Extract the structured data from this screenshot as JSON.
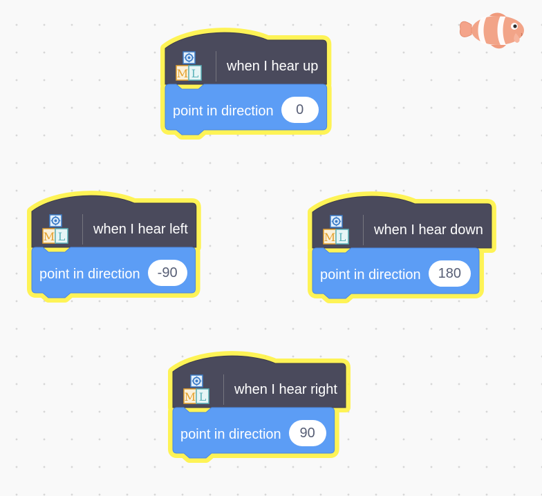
{
  "stacks": [
    {
      "hat_label": "when I hear up",
      "command_label": "point in direction",
      "value": "0",
      "icon": "ml-blocks-icon"
    },
    {
      "hat_label": "when I hear left",
      "command_label": "point in direction",
      "value": "-90",
      "icon": "ml-blocks-icon"
    },
    {
      "hat_label": "when I hear down",
      "command_label": "point in direction",
      "value": "180",
      "icon": "ml-blocks-icon"
    },
    {
      "hat_label": "when I hear right",
      "command_label": "point in direction",
      "value": "90",
      "icon": "ml-blocks-icon"
    }
  ],
  "icon_letters": {
    "left": "M",
    "right": "L"
  },
  "sprite": {
    "icon": "clownfish-sprite-icon"
  },
  "colors": {
    "hat_block": "#4a4a5c",
    "command_block": "#5c9df5",
    "glow": "#fff23a",
    "workspace": "#f9f9f9"
  }
}
